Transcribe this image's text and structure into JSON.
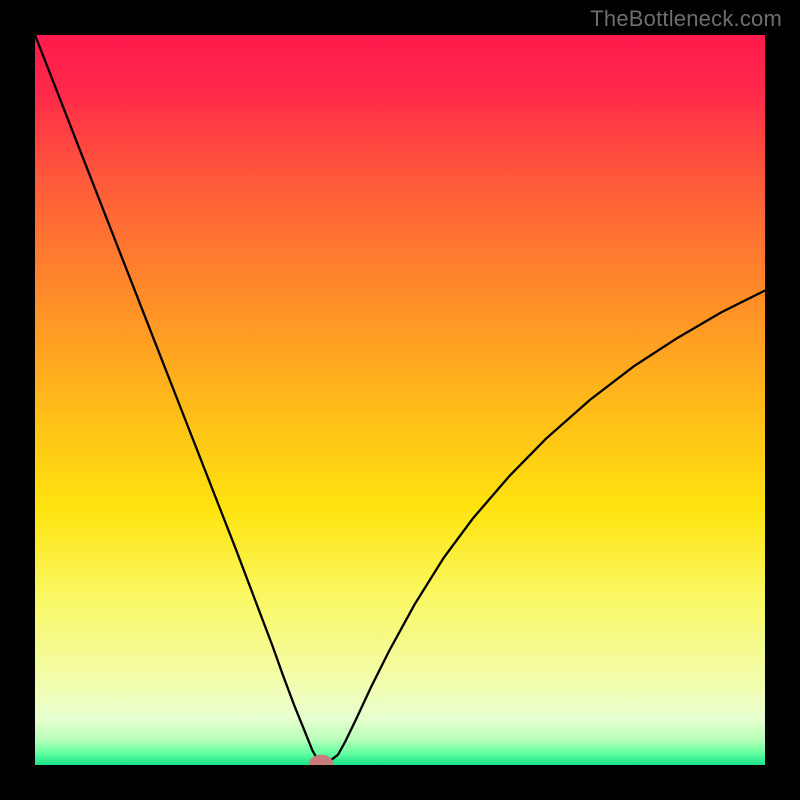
{
  "watermark": "TheBottleneck.com",
  "chart_data": {
    "type": "line",
    "title": "",
    "xlabel": "",
    "ylabel": "",
    "xlim": [
      0,
      100
    ],
    "ylim": [
      0,
      100
    ],
    "grid": false,
    "legend": false,
    "background_gradient_stops": [
      {
        "offset": 0.0,
        "color": "#ff1a4d"
      },
      {
        "offset": 0.08,
        "color": "#ff2a4a"
      },
      {
        "offset": 0.2,
        "color": "#ff5a3a"
      },
      {
        "offset": 0.35,
        "color": "#ff8a2a"
      },
      {
        "offset": 0.5,
        "color": "#ffb81a"
      },
      {
        "offset": 0.65,
        "color": "#ffe40f"
      },
      {
        "offset": 0.78,
        "color": "#f9f96a"
      },
      {
        "offset": 0.88,
        "color": "#f3fca8"
      },
      {
        "offset": 0.935,
        "color": "#e8ffcf"
      },
      {
        "offset": 0.965,
        "color": "#b9ffba"
      },
      {
        "offset": 0.985,
        "color": "#5dff9e"
      },
      {
        "offset": 1.0,
        "color": "#18e08a"
      }
    ],
    "series": [
      {
        "name": "bottleneck-curve",
        "color": "#000000",
        "stroke_width": 2.3,
        "x": [
          0.0,
          2.5,
          5.0,
          7.5,
          10.0,
          12.5,
          15.0,
          17.5,
          20.0,
          22.5,
          25.0,
          27.5,
          30.0,
          32.5,
          34.0,
          35.5,
          37.0,
          38.0,
          38.8,
          39.3,
          39.8,
          41.5,
          42.5,
          44.0,
          46.0,
          48.5,
          52.0,
          56.0,
          60.0,
          65.0,
          70.0,
          76.0,
          82.0,
          88.0,
          94.0,
          100.0
        ],
        "y": [
          100.0,
          93.6,
          87.2,
          80.8,
          74.4,
          68.0,
          61.6,
          55.2,
          48.8,
          42.4,
          36.0,
          29.6,
          23.0,
          16.4,
          12.2,
          8.2,
          4.5,
          2.0,
          0.6,
          0.1,
          0.1,
          1.4,
          3.2,
          6.3,
          10.6,
          15.6,
          22.0,
          28.4,
          33.8,
          39.6,
          44.7,
          50.0,
          54.6,
          58.5,
          62.0,
          65.0
        ]
      }
    ],
    "marker": {
      "x": 39.2,
      "y": 0.3,
      "rx": 1.6,
      "ry": 1.1,
      "fill": "#c97a7a"
    }
  }
}
